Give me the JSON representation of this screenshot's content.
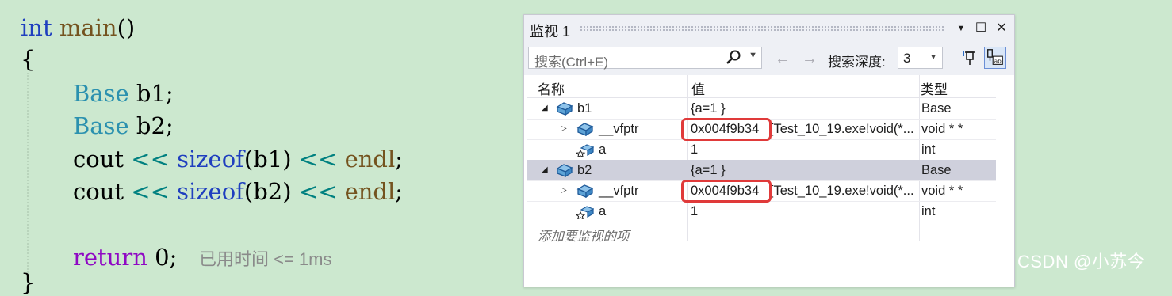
{
  "editor": {
    "line1": {
      "kw": "int",
      "fn": "main",
      "rest": "()"
    },
    "line2": "{",
    "line3": {
      "type": "Base",
      "rest": " b1;"
    },
    "line4": {
      "type": "Base",
      "rest": " b2;"
    },
    "line5": {
      "a": "cout ",
      "op": "<<",
      "b": " ",
      "kw": "sizeof",
      "c": "(b1) ",
      "op2": "<<",
      "d": " ",
      "fn": "endl",
      "e": ";"
    },
    "line6": {
      "a": "cout ",
      "op": "<<",
      "b": " ",
      "kw": "sizeof",
      "c": "(b2) ",
      "op2": "<<",
      "d": " ",
      "fn": "endl",
      "e": ";"
    },
    "line7": {
      "kw": "return",
      "rest": " 0;",
      "hint": "已用时间 <= 1ms"
    },
    "line8": "}"
  },
  "watermark": "CSDN @小苏今",
  "watch": {
    "title": "监视 1",
    "buttons": {
      "dropdown": "▼",
      "maximize": "☐",
      "close": "✕"
    },
    "search_placeholder": "搜索(Ctrl+E)",
    "back_arrow": "←",
    "forward_arrow": "→",
    "depth_label": "搜索深度:",
    "depth_value": "3",
    "columns": {
      "name": "名称",
      "value": "值",
      "type": "类型"
    },
    "rows": [
      {
        "name": "b1",
        "value": "{a=1 }",
        "type": "Base",
        "expander": "◢",
        "selected": false
      },
      {
        "name": "__vfptr",
        "value": "0x004f9b34",
        "value_rest": "{Test_10_19.exe!void(*...",
        "type": "void * *",
        "expander": "▷"
      },
      {
        "name": "a",
        "value": "1",
        "type": "int",
        "expander": ""
      },
      {
        "name": "b2",
        "value": "{a=1 }",
        "type": "Base",
        "expander": "◢",
        "selected": true
      },
      {
        "name": "__vfptr",
        "value": "0x004f9b34",
        "value_rest": "{Test_10_19.exe!void(*...",
        "type": "void * *",
        "expander": "▷"
      },
      {
        "name": "a",
        "value": "1",
        "type": "int",
        "expander": ""
      }
    ],
    "add_watch": "添加要监视的项"
  },
  "colors": {
    "editor_bg": "#cce8cf",
    "highlight_box": "#e03a3a",
    "selected_row": "#cfd0dc"
  }
}
